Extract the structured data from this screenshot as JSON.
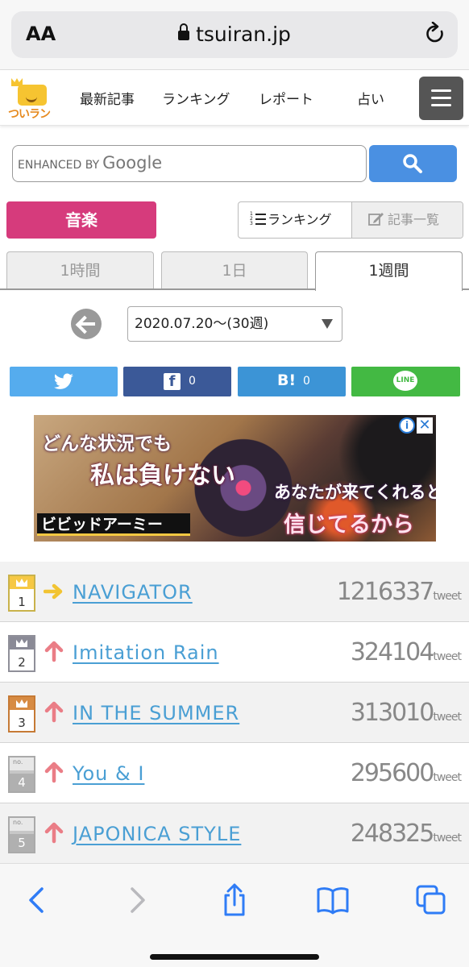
{
  "browser": {
    "text_size_label": "AA",
    "url": "tsuiran.jp"
  },
  "site": {
    "logo_text": "ついラン",
    "nav": [
      "最新記事",
      "ランキング",
      "レポート",
      "占い"
    ]
  },
  "search": {
    "placeholder_prefix": "ENHANCED BY",
    "placeholder_brand": "Google"
  },
  "category": {
    "label": "音楽"
  },
  "view_toggle": {
    "ranking_label": "ランキング",
    "articles_label": "記事一覧"
  },
  "period_tabs": [
    {
      "label": "1時間",
      "active": false
    },
    {
      "label": "1日",
      "active": false
    },
    {
      "label": "1週間",
      "active": true
    }
  ],
  "date_selector": {
    "value": "2020.07.20〜(30週)"
  },
  "share": {
    "facebook_count": "0",
    "hatena_count": "0",
    "hatena_mark": "B!",
    "line_label": "LINE"
  },
  "ad": {
    "line1": "どんな状況でも",
    "line2": "私は負けない",
    "line3": "あなたが来てくれると",
    "line4": "信じてるから",
    "brand": "ビビッドアーミー",
    "info_mark": "i",
    "close_mark": "✕"
  },
  "ranking": [
    {
      "rank": "1",
      "trend": "same",
      "title": "NAVIGATOR",
      "count": "1216337",
      "unit": "tweet",
      "badge": "gold"
    },
    {
      "rank": "2",
      "trend": "up",
      "title": "Imitation Rain",
      "count": "324104",
      "unit": "tweet",
      "badge": "silver"
    },
    {
      "rank": "3",
      "trend": "up",
      "title": "IN THE SUMMER",
      "count": "313010",
      "unit": "tweet",
      "badge": "bronze"
    },
    {
      "rank": "4",
      "trend": "up",
      "title": "You & I",
      "count": "295600",
      "unit": "tweet",
      "badge": "grey",
      "badge_prefix": "no."
    },
    {
      "rank": "5",
      "trend": "up",
      "title": "JAPONICA STYLE",
      "count": "248325",
      "unit": "tweet",
      "badge": "grey",
      "badge_prefix": "no."
    }
  ],
  "colors": {
    "category": "#d63b7c",
    "search_button": "#4a90e2",
    "twitter": "#55acee",
    "facebook": "#3b5998",
    "hatena": "#3c94d6",
    "line": "#43b943",
    "link": "#4a9fd4",
    "trend_same": "#f2c432",
    "trend_up": "#ea7d86",
    "safari_tint": "#2f7cf6"
  }
}
